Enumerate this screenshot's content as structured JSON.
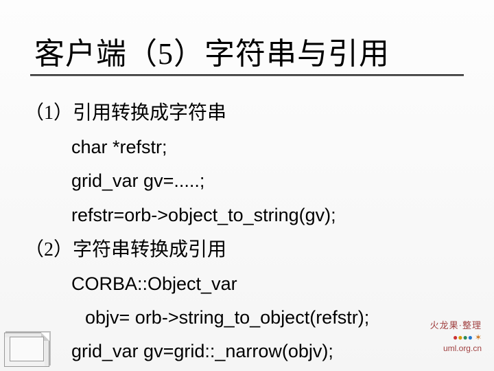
{
  "title": "客户端（5）字符串与引用",
  "body": {
    "section1_heading": "（1）引用转换成字符串",
    "section1_lines": [
      "char *refstr;",
      "grid_var gv=.....;",
      "refstr=orb->object_to_string(gv);"
    ],
    "section2_heading": "（2）字符串转换成引用",
    "section2_lines": [
      "CORBA::Object_var",
      "objv= orb->string_to_object(refstr);",
      "grid_var gv=grid::_narrow(objv);"
    ]
  },
  "watermark": {
    "line1": "火龙果·整理",
    "url": "uml.org.cn"
  }
}
